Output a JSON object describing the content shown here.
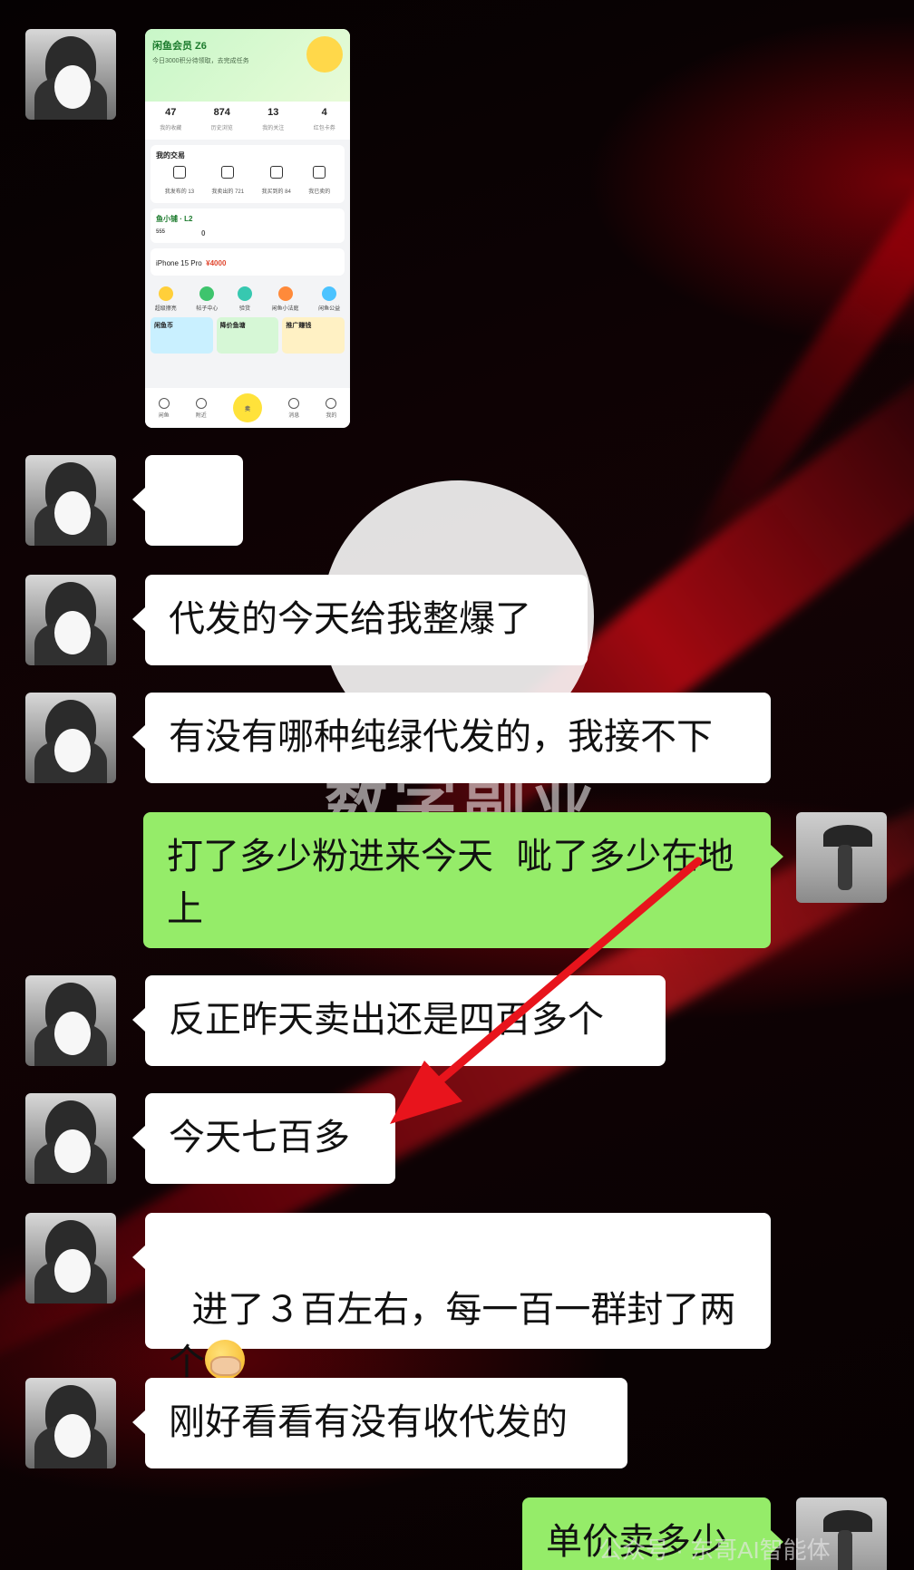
{
  "screenshot": {
    "app_title": "闲鱼会员 Z6",
    "subtitle": "今日3000积分待领取，去完成任务",
    "stats": [
      {
        "value": "47",
        "label": "我的收藏"
      },
      {
        "value": "874",
        "label": "历史浏览"
      },
      {
        "value": "13",
        "label": "我的关注"
      },
      {
        "value": "4",
        "label": "红包卡券"
      }
    ],
    "trade_title": "我的交易",
    "trade_items": [
      "我发布的 13",
      "我卖出的 721",
      "我买到的 84",
      "我已卖的"
    ],
    "sub_title": "鱼小铺 · L2",
    "sub_points": "555",
    "sub_zero": "0",
    "phone_name": "iPhone 15 Pro",
    "phone_price": "¥4000",
    "grid": [
      "超级擦亮",
      "帖子中心",
      "验货",
      "闲鱼小法庭",
      "闲鱼公益"
    ],
    "banners": [
      "闲鱼币",
      "降价鱼塘",
      "推广赚钱"
    ],
    "tabs": [
      "闲鱼",
      "附近",
      "卖",
      "消息",
      "我的"
    ],
    "sell_label": "卖"
  },
  "messages": [
    {
      "side": "in",
      "type": "emoji"
    },
    {
      "side": "in",
      "text": "代发的今天给我整爆了"
    },
    {
      "side": "in",
      "text": "有没有哪种纯绿代发的，我接不下"
    },
    {
      "side": "out",
      "text": "打了多少粉进来今天  呲了多少在地上"
    },
    {
      "side": "in",
      "text": "反正昨天卖出还是四百多个"
    },
    {
      "side": "in",
      "text": "今天七百多"
    },
    {
      "side": "in",
      "text": "进了３百左右，每一百一群封了两个"
    },
    {
      "side": "in",
      "text": "刚好看看有没有收代发的"
    },
    {
      "side": "out",
      "text": "单价卖多少"
    }
  ],
  "wallpaper_text": "数字副业",
  "watermark": "公众号 · 东哥AI智能体",
  "colors": {
    "incoming_bubble": "#ffffff",
    "outgoing_bubble": "#95ec69",
    "arrow": "#e8141c"
  }
}
